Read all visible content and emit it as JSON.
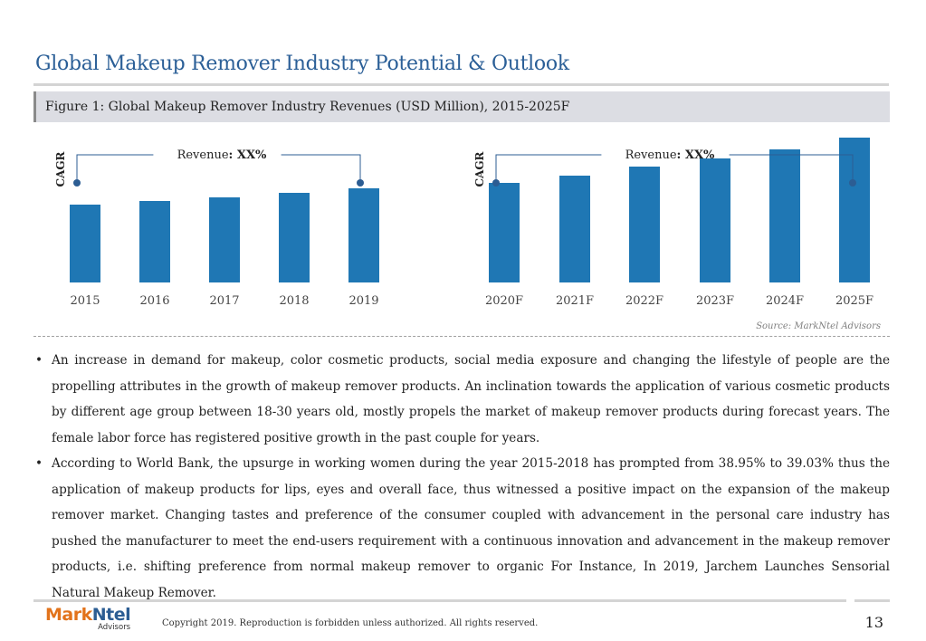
{
  "page": {
    "title": "Global Makeup Remover Industry Potential & Outlook",
    "figure_caption": "Figure 1: Global Makeup Remover Industry Revenues (USD Million), 2015-2025F",
    "source": "Source: MarkNtel Advisors",
    "bullets": [
      "An increase in demand for makeup, color cosmetic products, social media exposure and changing the lifestyle of people are the propelling attributes in the growth of makeup remover products. An inclination towards the application of various cosmetic products by different age group between 18-30 years old, mostly propels the market of makeup remover products during forecast years. The female labor force has registered positive growth in the past couple for years.",
      "According to World Bank, the upsurge in working women during the year 2015-2018 has prompted from 38.95% to 39.03% thus the application of makeup products for lips, eyes and overall face, thus witnessed a positive impact on the expansion of the makeup remover market. Changing tastes and preference of the consumer coupled with advancement in the personal care industry has pushed the manufacturer to meet the end-users requirement with a continuous innovation and advancement in the makeup remover products, i.e. shifting preference from normal makeup remover to organic For Instance, In 2019, Jarchem Launches Sensorial Natural Makeup Remover."
    ]
  },
  "footer": {
    "logo_part1": "Mark",
    "logo_part2": "Ntel",
    "logo_sub": "Advisors",
    "copyright": "Copyright 2019. Reproduction is forbidden unless authorized. All rights reserved.",
    "page_number": "13"
  },
  "colors": {
    "bar": "#1f77b4",
    "title": "#2b5f97",
    "bracket": "#2c5d93"
  },
  "chart_data": [
    {
      "type": "bar",
      "categories": [
        "2015",
        "2016",
        "2017",
        "2018",
        "2019"
      ],
      "values": [
        43,
        45,
        47,
        49.5,
        52
      ],
      "ylim": [
        0,
        100
      ],
      "grid": false,
      "cagr_label": "CAGR",
      "revenue_label": "Revenue",
      "revenue_value": "XX%",
      "revenue_sep": ": "
    },
    {
      "type": "bar",
      "categories": [
        "2020F",
        "2021F",
        "2022F",
        "2023F",
        "2024F",
        "2025F"
      ],
      "values": [
        55,
        59,
        64,
        68.5,
        73.5,
        80
      ],
      "ylim": [
        0,
        100
      ],
      "grid": false,
      "cagr_label": "CAGR",
      "revenue_label": "Revenue",
      "revenue_value": "XX%",
      "revenue_sep": ": "
    }
  ]
}
